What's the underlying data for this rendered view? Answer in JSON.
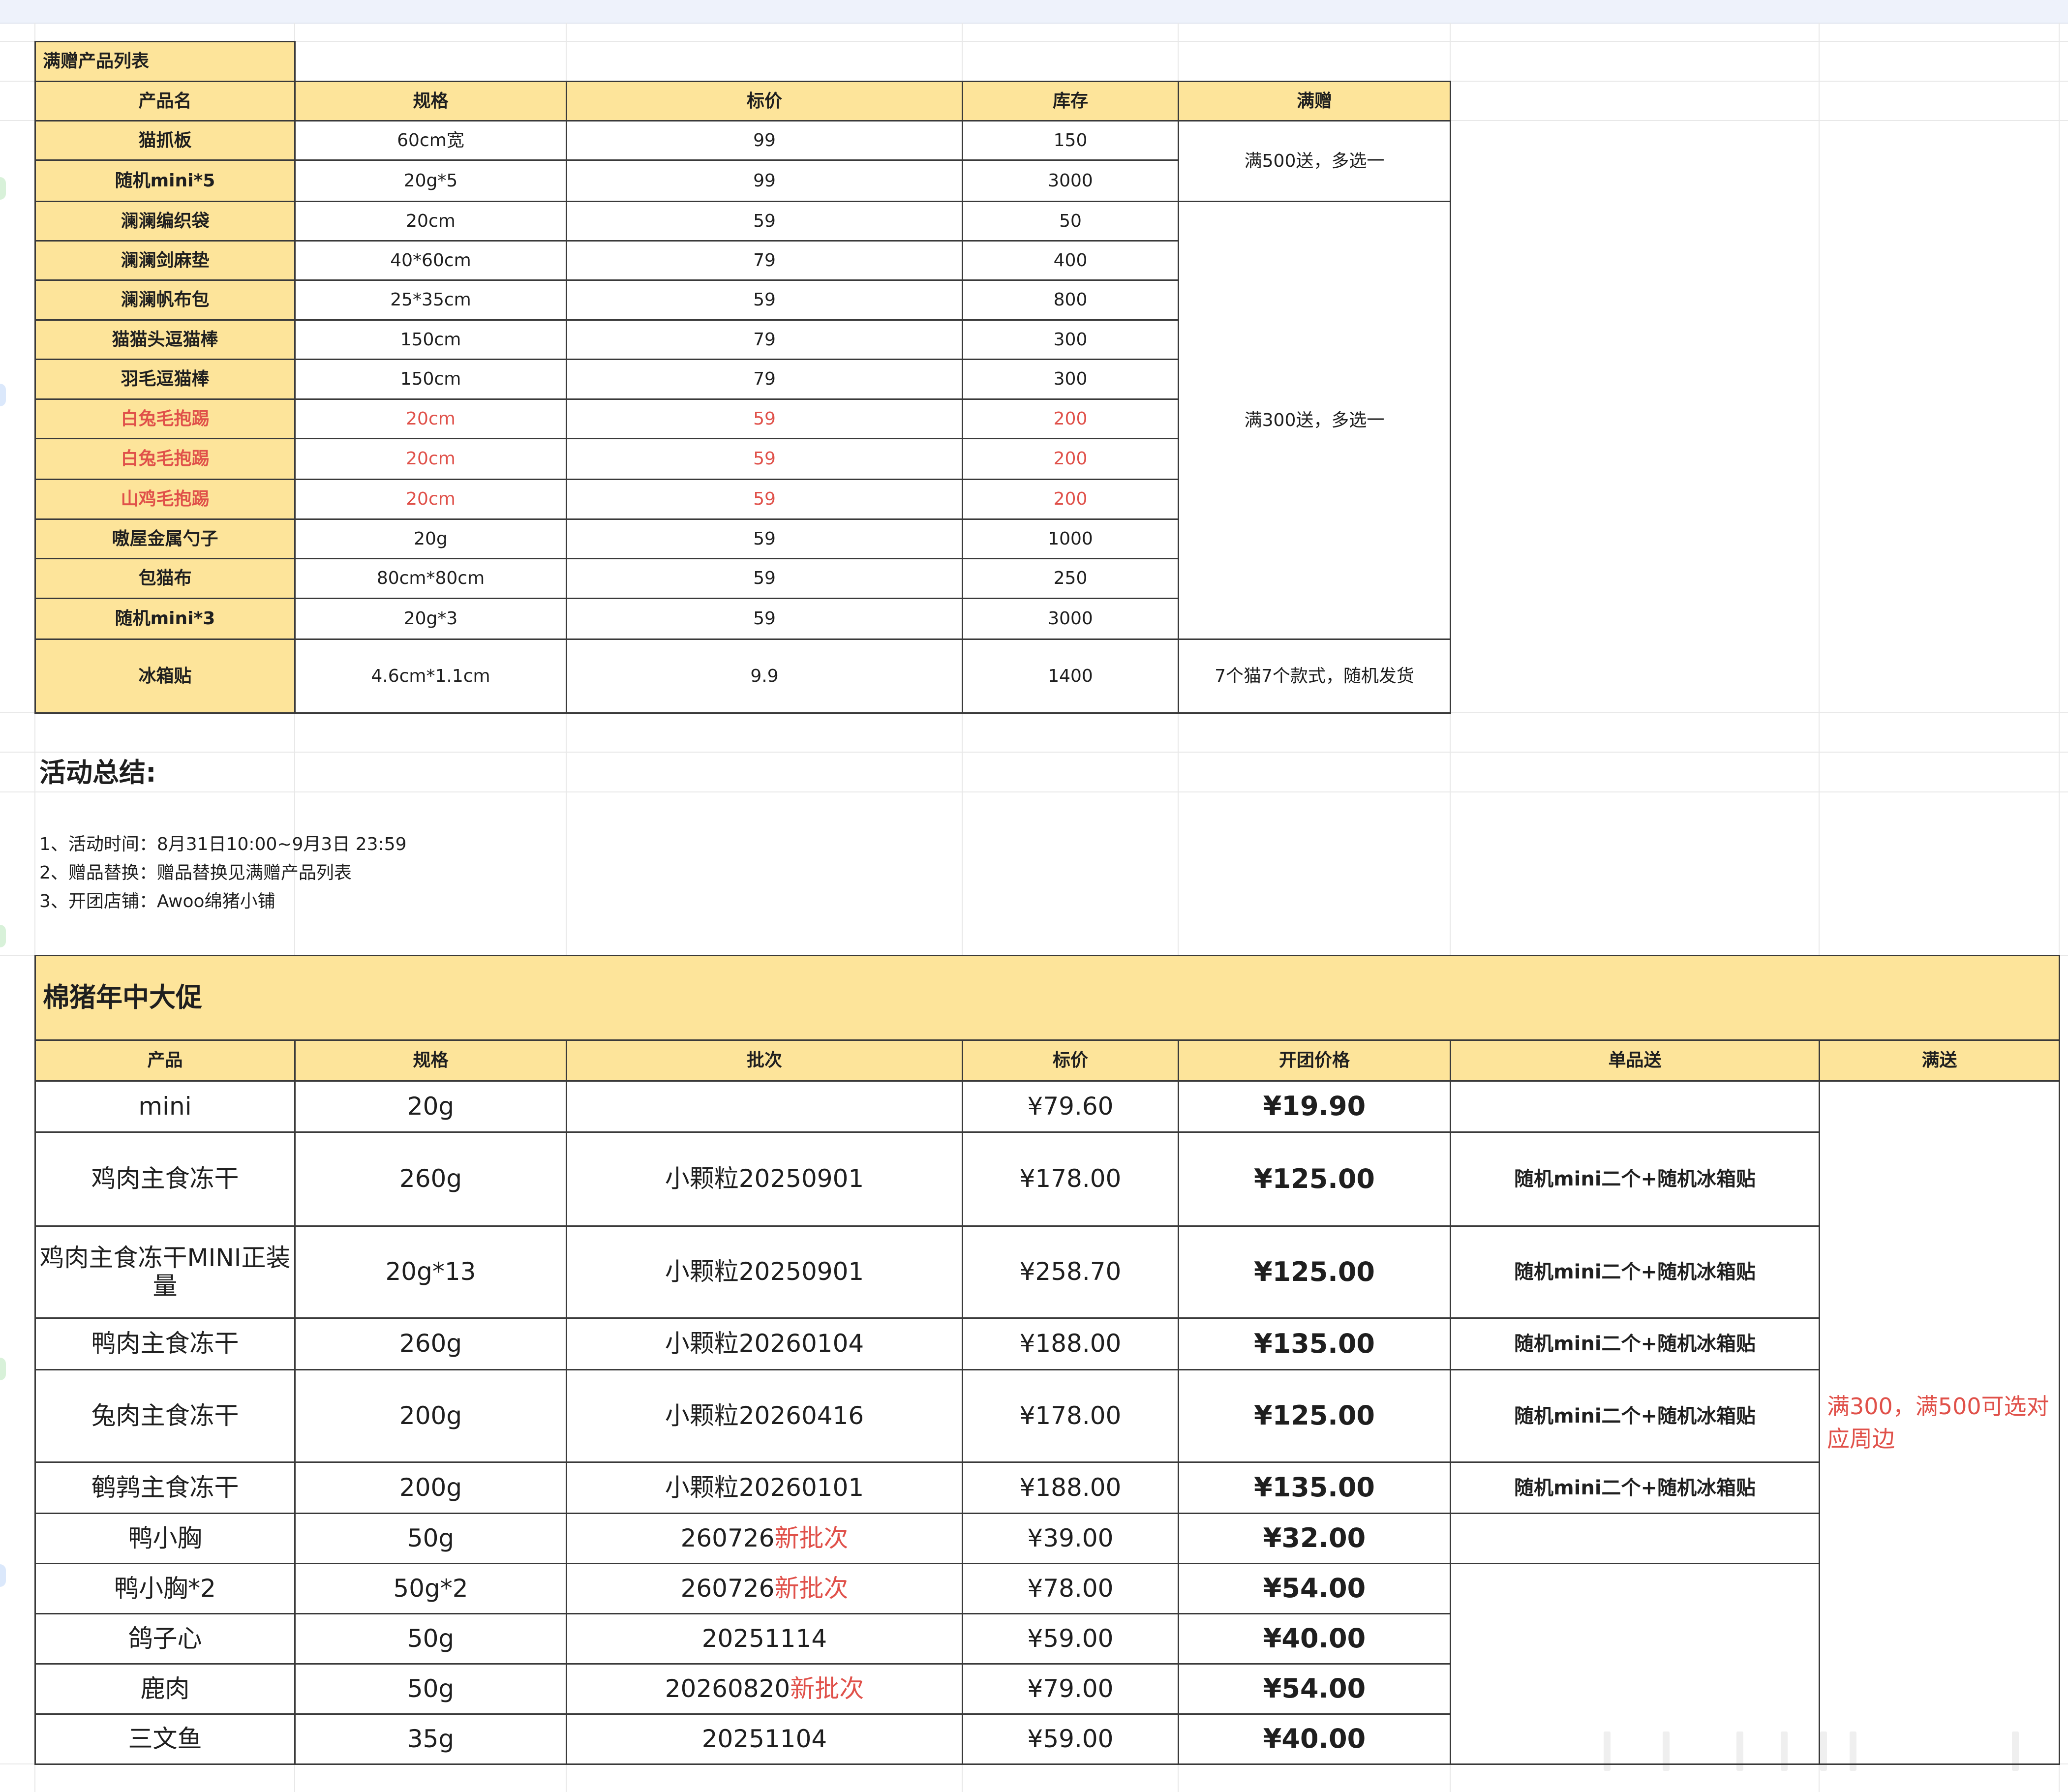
{
  "gift_table": {
    "title": "满赠产品列表",
    "headers": [
      "产品名",
      "规格",
      "标价",
      "库存",
      "满赠"
    ],
    "rows": [
      {
        "name": "猫抓板",
        "spec": "60cm宽",
        "price": "99",
        "stock": "150",
        "red": false
      },
      {
        "name": "随机mini*5",
        "spec": "20g*5",
        "price": "99",
        "stock": "3000",
        "red": false
      },
      {
        "name": "澜澜编织袋",
        "spec": "20cm",
        "price": "59",
        "stock": "50",
        "red": false
      },
      {
        "name": "澜澜剑麻垫",
        "spec": "40*60cm",
        "price": "79",
        "stock": "400",
        "red": false
      },
      {
        "name": "澜澜帆布包",
        "spec": "25*35cm",
        "price": "59",
        "stock": "800",
        "red": false
      },
      {
        "name": "猫猫头逗猫棒",
        "spec": "150cm",
        "price": "79",
        "stock": "300",
        "red": false
      },
      {
        "name": "羽毛逗猫棒",
        "spec": "150cm",
        "price": "79",
        "stock": "300",
        "red": false
      },
      {
        "name": "白兔毛抱踢",
        "spec": "20cm",
        "price": "59",
        "stock": "200",
        "red": true
      },
      {
        "name": "白兔毛抱踢",
        "spec": "20cm",
        "price": "59",
        "stock": "200",
        "red": true
      },
      {
        "name": "山鸡毛抱踢",
        "spec": "20cm",
        "price": "59",
        "stock": "200",
        "red": true
      },
      {
        "name": "嗷屋金属勺子",
        "spec": "20g",
        "price": "59",
        "stock": "1000",
        "red": false
      },
      {
        "name": "包猫布",
        "spec": "80cm*80cm",
        "price": "59",
        "stock": "250",
        "red": false
      },
      {
        "name": "随机mini*3",
        "spec": "20g*3",
        "price": "59",
        "stock": "3000",
        "red": false
      },
      {
        "name": "冰箱贴",
        "spec": "4.6cm*1.1cm",
        "price": "9.9",
        "stock": "1400",
        "red": false
      }
    ],
    "gift_500": "满500送，多选一",
    "gift_300": "满300送，多选一",
    "gift_magnet": "7个猫7个款式，随机发货"
  },
  "summary": {
    "title": "活动总结:",
    "lines": [
      "1、活动时间：8月31日10:00~9月3日 23:59",
      "2、赠品替换：赠品替换见满赠产品列表",
      "3、开团店铺：Awoo绵猪小铺"
    ]
  },
  "promo": {
    "title": "棉猪年中大促",
    "headers": [
      "产品",
      "规格",
      "批次",
      "标价",
      "开团价格",
      "单品送",
      "满送"
    ],
    "rows": [
      {
        "product": "mini",
        "spec": "20g",
        "batch": "",
        "batch_tag": "",
        "price": "¥79.60",
        "group": "¥19.90",
        "gift": ""
      },
      {
        "product": "鸡肉主食冻干",
        "spec": "260g",
        "batch": "小颗粒20250901",
        "batch_tag": "",
        "price": "¥178.00",
        "group": "¥125.00",
        "gift": "随机mini二个+随机冰箱贴"
      },
      {
        "product": "鸡肉主食冻干MINI正装量",
        "spec": "20g*13",
        "batch": "小颗粒20250901",
        "batch_tag": "",
        "price": "¥258.70",
        "group": "¥125.00",
        "gift": "随机mini二个+随机冰箱贴"
      },
      {
        "product": "鸭肉主食冻干",
        "spec": "260g",
        "batch": "小颗粒20260104",
        "batch_tag": "",
        "price": "¥188.00",
        "group": "¥135.00",
        "gift": "随机mini二个+随机冰箱贴"
      },
      {
        "product": "兔肉主食冻干",
        "spec": "200g",
        "batch": "小颗粒20260416",
        "batch_tag": "",
        "price": "¥178.00",
        "group": "¥125.00",
        "gift": "随机mini二个+随机冰箱贴"
      },
      {
        "product": "鹌鹑主食冻干",
        "spec": "200g",
        "batch": "小颗粒20260101",
        "batch_tag": "",
        "price": "¥188.00",
        "group": "¥135.00",
        "gift": "随机mini二个+随机冰箱贴"
      },
      {
        "product": "鸭小胸",
        "spec": "50g",
        "batch": "260726",
        "batch_tag": "新批次",
        "price": "¥39.00",
        "group": "¥32.00",
        "gift": ""
      },
      {
        "product": "鸭小胸*2",
        "spec": "50g*2",
        "batch": "260726",
        "batch_tag": "新批次",
        "price": "¥78.00",
        "group": "¥54.00",
        "gift": ""
      },
      {
        "product": "鸽子心",
        "spec": "50g",
        "batch": "20251114",
        "batch_tag": "",
        "price": "¥59.00",
        "group": "¥40.00",
        "gift": ""
      },
      {
        "product": "鹿肉",
        "spec": "50g",
        "batch": "20260820",
        "batch_tag": "新批次",
        "price": "¥79.00",
        "group": "¥54.00",
        "gift": ""
      },
      {
        "product": "三文鱼",
        "spec": "35g",
        "batch": "20251104",
        "batch_tag": "",
        "price": "¥59.00",
        "group": "¥40.00",
        "gift": ""
      }
    ],
    "full_gift": "满300，满500可选对应周边"
  },
  "colors": {
    "header_fill": "#fde49a",
    "highlight_red": "#e0514a",
    "border": "#3a3a3a",
    "gridline": "#e8e8e8"
  }
}
